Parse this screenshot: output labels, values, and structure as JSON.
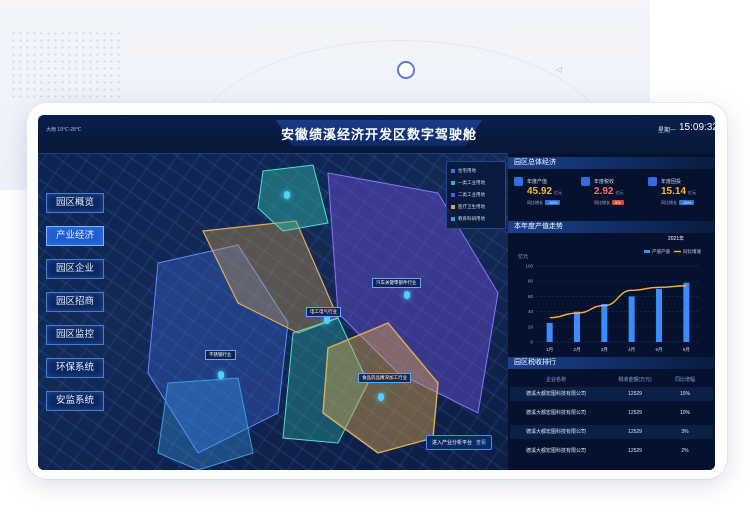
{
  "header": {
    "title": "安徽绩溪经济开发区数字驾驶舱",
    "weather": "大雨  19℃-28℃",
    "weekday": "星期一",
    "time": "15:09:32"
  },
  "nav": [
    {
      "label": "园区概览",
      "active": false
    },
    {
      "label": "产业经济",
      "active": true
    },
    {
      "label": "园区企业",
      "active": false
    },
    {
      "label": "园区招商",
      "active": false
    },
    {
      "label": "园区监控",
      "active": false
    },
    {
      "label": "环保系统",
      "active": false
    },
    {
      "label": "安监系统",
      "active": false
    }
  ],
  "map": {
    "legend": [
      {
        "label": "住宅用地",
        "color": "#3f6be0"
      },
      {
        "label": "一类工业用地",
        "color": "#2fb7a8"
      },
      {
        "label": "二类工业用地",
        "color": "#6a4fd8"
      },
      {
        "label": "医疗卫生用地",
        "color": "#d9a54a"
      },
      {
        "label": "教育科研用地",
        "color": "#3a9be6"
      }
    ],
    "zones": [
      {
        "label": "汽车关键零部件行业"
      },
      {
        "label": "电工电气行业"
      },
      {
        "label": "不锈钢行业"
      },
      {
        "label": "食品药品精深加工行业"
      }
    ],
    "enter_button": "进入产业分析平台",
    "enter_more": "查看"
  },
  "economy": {
    "section_title": "园区总体经济",
    "kpis": [
      {
        "label": "年度产值",
        "value": "45.92",
        "unit": "亿元",
        "cmp_label": "同比增长",
        "cmp_value": "-34%",
        "color": "#f5b53a",
        "badge": "#2a73d9"
      },
      {
        "label": "年度税收",
        "value": "2.92",
        "unit": "亿元",
        "cmp_label": "同比增长",
        "cmp_value": "5%",
        "color": "#ff6b6b",
        "badge": "#d9453f"
      },
      {
        "label": "年度固投",
        "value": "15.14",
        "unit": "亿元",
        "cmp_label": "同比增长",
        "cmp_value": "-34%",
        "color": "#f5b53a",
        "badge": "#2a73d9"
      }
    ]
  },
  "trend": {
    "section_title": "本年度产值走势",
    "year": "2021年"
  },
  "chart_data": {
    "type": "bar",
    "title": "本年度产值走势",
    "categories": [
      "1月",
      "2月",
      "3月",
      "4月",
      "5月",
      "6月"
    ],
    "ylabel": "亿元",
    "ylim": [
      0,
      100
    ],
    "yticks": [
      0,
      20,
      40,
      60,
      80,
      100
    ],
    "series": [
      {
        "name": "产值产值",
        "kind": "bar",
        "color": "#3a8cff",
        "values": [
          25,
          40,
          50,
          60,
          70,
          78
        ]
      },
      {
        "name": "同比增速",
        "kind": "line",
        "color": "#f5b53a",
        "values": [
          32,
          38,
          48,
          68,
          72,
          74
        ]
      }
    ],
    "legend_position": "top-right",
    "grid": true
  },
  "ranking": {
    "section_title": "园区税收排行",
    "columns": [
      "企业名称",
      "税收金额(万元)",
      "同比增幅"
    ],
    "rows": [
      [
        "德溪大都宏图科技有限公司",
        "12529",
        "15%"
      ],
      [
        "德溪大都宏图科技有限公司",
        "12529",
        "10%"
      ],
      [
        "德溪大都宏图科技有限公司",
        "12529",
        "3%"
      ],
      [
        "德溪大都宏图科技有限公司",
        "12529",
        "2%"
      ]
    ]
  }
}
